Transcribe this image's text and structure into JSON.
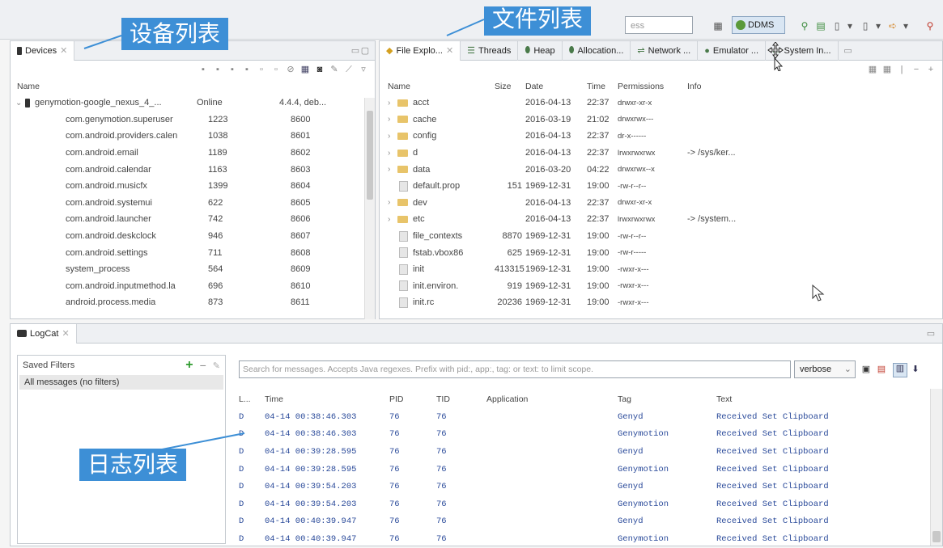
{
  "toolbar": {
    "quick_access_placeholder": "ess",
    "ddms_label": "DDMS"
  },
  "callouts": {
    "devices": "设备列表",
    "files": "文件列表",
    "logs": "日志列表"
  },
  "devices_panel": {
    "tab_label": "Devices",
    "headers": {
      "name": "Name"
    },
    "device": {
      "name": "genymotion-google_nexus_4_...",
      "status": "Online",
      "info": "4.4.4, deb..."
    },
    "processes": [
      {
        "name": "com.genymotion.superuser",
        "pid": "1223",
        "port": "8600"
      },
      {
        "name": "com.android.providers.calen",
        "pid": "1038",
        "port": "8601"
      },
      {
        "name": "com.android.email",
        "pid": "1189",
        "port": "8602"
      },
      {
        "name": "com.android.calendar",
        "pid": "1163",
        "port": "8603"
      },
      {
        "name": "com.android.musicfx",
        "pid": "1399",
        "port": "8604"
      },
      {
        "name": "com.android.systemui",
        "pid": "622",
        "port": "8605"
      },
      {
        "name": "com.android.launcher",
        "pid": "742",
        "port": "8606"
      },
      {
        "name": "com.android.deskclock",
        "pid": "946",
        "port": "8607"
      },
      {
        "name": "com.android.settings",
        "pid": "711",
        "port": "8608"
      },
      {
        "name": "system_process",
        "pid": "564",
        "port": "8609"
      },
      {
        "name": "com.android.inputmethod.la",
        "pid": "696",
        "port": "8610"
      },
      {
        "name": "android.process.media",
        "pid": "873",
        "port": "8611"
      }
    ]
  },
  "explorer_panel": {
    "tabs": [
      "File Explo...",
      "Threads",
      "Heap",
      "Allocation...",
      "Network ...",
      "Emulator ...",
      "System In..."
    ],
    "headers": {
      "name": "Name",
      "size": "Size",
      "date": "Date",
      "time": "Time",
      "permissions": "Permissions",
      "info": "Info"
    },
    "rows": [
      {
        "name": "acct",
        "size": "",
        "date": "2016-04-13",
        "time": "22:37",
        "perm": "drwxr-xr-x",
        "info": "",
        "folder": true
      },
      {
        "name": "cache",
        "size": "",
        "date": "2016-03-19",
        "time": "21:02",
        "perm": "drwxrwx---",
        "info": "",
        "folder": true
      },
      {
        "name": "config",
        "size": "",
        "date": "2016-04-13",
        "time": "22:37",
        "perm": "dr-x------",
        "info": "",
        "folder": true
      },
      {
        "name": "d",
        "size": "",
        "date": "2016-04-13",
        "time": "22:37",
        "perm": "lrwxrwxrwx",
        "info": "-> /sys/ker...",
        "folder": true
      },
      {
        "name": "data",
        "size": "",
        "date": "2016-03-20",
        "time": "04:22",
        "perm": "drwxrwx--x",
        "info": "",
        "folder": true
      },
      {
        "name": "default.prop",
        "size": "151",
        "date": "1969-12-31",
        "time": "19:00",
        "perm": "-rw-r--r--",
        "info": "",
        "folder": false
      },
      {
        "name": "dev",
        "size": "",
        "date": "2016-04-13",
        "time": "22:37",
        "perm": "drwxr-xr-x",
        "info": "",
        "folder": true
      },
      {
        "name": "etc",
        "size": "",
        "date": "2016-04-13",
        "time": "22:37",
        "perm": "lrwxrwxrwx",
        "info": "-> /system...",
        "folder": true
      },
      {
        "name": "file_contexts",
        "size": "8870",
        "date": "1969-12-31",
        "time": "19:00",
        "perm": "-rw-r--r--",
        "info": "",
        "folder": false
      },
      {
        "name": "fstab.vbox86",
        "size": "625",
        "date": "1969-12-31",
        "time": "19:00",
        "perm": "-rw-r-----",
        "info": "",
        "folder": false
      },
      {
        "name": "init",
        "size": "413315",
        "date": "1969-12-31",
        "time": "19:00",
        "perm": "-rwxr-x---",
        "info": "",
        "folder": false
      },
      {
        "name": "init.environ.",
        "size": "919",
        "date": "1969-12-31",
        "time": "19:00",
        "perm": "-rwxr-x---",
        "info": "",
        "folder": false
      },
      {
        "name": "init.rc",
        "size": "20236",
        "date": "1969-12-31",
        "time": "19:00",
        "perm": "-rwxr-x---",
        "info": "",
        "folder": false
      }
    ]
  },
  "logcat_panel": {
    "tab_label": "LogCat",
    "saved_filters_label": "Saved Filters",
    "filters": [
      "All messages (no filters)"
    ],
    "search_placeholder": "Search for messages. Accepts Java regexes. Prefix with pid:, app:, tag: or text: to limit scope.",
    "level_select": "verbose",
    "headers": {
      "level": "L...",
      "time": "Time",
      "pid": "PID",
      "tid": "TID",
      "application": "Application",
      "tag": "Tag",
      "text": "Text"
    },
    "rows": [
      {
        "level": "D",
        "time": "04-14 00:38:46.303",
        "pid": "76",
        "tid": "76",
        "app": "",
        "tag": "Genyd",
        "text": "Received Set Clipboard"
      },
      {
        "level": "D",
        "time": "04-14 00:38:46.303",
        "pid": "76",
        "tid": "76",
        "app": "",
        "tag": "Genymotion",
        "text": "Received Set Clipboard"
      },
      {
        "level": "D",
        "time": "04-14 00:39:28.595",
        "pid": "76",
        "tid": "76",
        "app": "",
        "tag": "Genyd",
        "text": "Received Set Clipboard"
      },
      {
        "level": "D",
        "time": "04-14 00:39:28.595",
        "pid": "76",
        "tid": "76",
        "app": "",
        "tag": "Genymotion",
        "text": "Received Set Clipboard"
      },
      {
        "level": "D",
        "time": "04-14 00:39:54.203",
        "pid": "76",
        "tid": "76",
        "app": "",
        "tag": "Genyd",
        "text": "Received Set Clipboard"
      },
      {
        "level": "D",
        "time": "04-14 00:39:54.203",
        "pid": "76",
        "tid": "76",
        "app": "",
        "tag": "Genymotion",
        "text": "Received Set Clipboard"
      },
      {
        "level": "D",
        "time": "04-14 00:40:39.947",
        "pid": "76",
        "tid": "76",
        "app": "",
        "tag": "Genyd",
        "text": "Received Set Clipboard"
      },
      {
        "level": "D",
        "time": "04-14 00:40:39.947",
        "pid": "76",
        "tid": "76",
        "app": "",
        "tag": "Genymotion",
        "text": "Received Set Clipboard"
      }
    ]
  },
  "colors": {
    "accent_callout": "#3d8fd6",
    "log_text": "#2a4a9a",
    "folder": "#e8c46a"
  }
}
